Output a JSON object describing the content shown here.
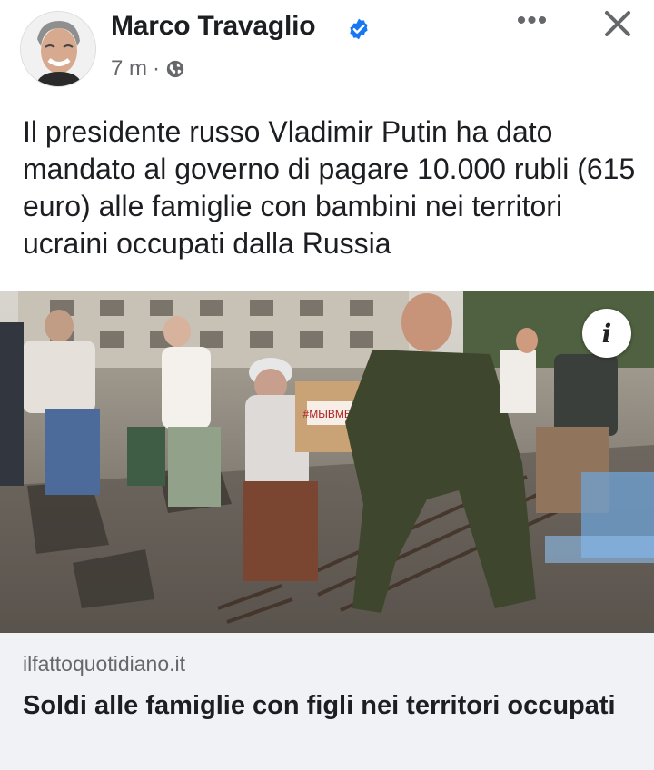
{
  "post": {
    "author": "Marco Travaglio",
    "time": "7 m",
    "separator": "·",
    "more_label": "•••",
    "text": "Il presidente russo Vladimir Putin ha dato mandato al governo di pagare 10.000 rubli (615 euro) alle famiglie con bambini nei territori ucraini occupati dalla Russia",
    "icons": {
      "verified": "verified-badge-icon",
      "audience": "globe-icon",
      "more": "more-options-icon",
      "close": "close-icon",
      "info": "info-icon"
    }
  },
  "photo": {
    "box_label": "#МЫВМЕСТЕ",
    "info_label": "i"
  },
  "link_preview": {
    "domain": "ilfattoquotidiano.it",
    "title": "Soldi alle famiglie con figli nei territori occupati"
  },
  "colors": {
    "verified": "#1877f2",
    "secondary_text": "#65676b",
    "link_bg": "#f0f2f5"
  }
}
